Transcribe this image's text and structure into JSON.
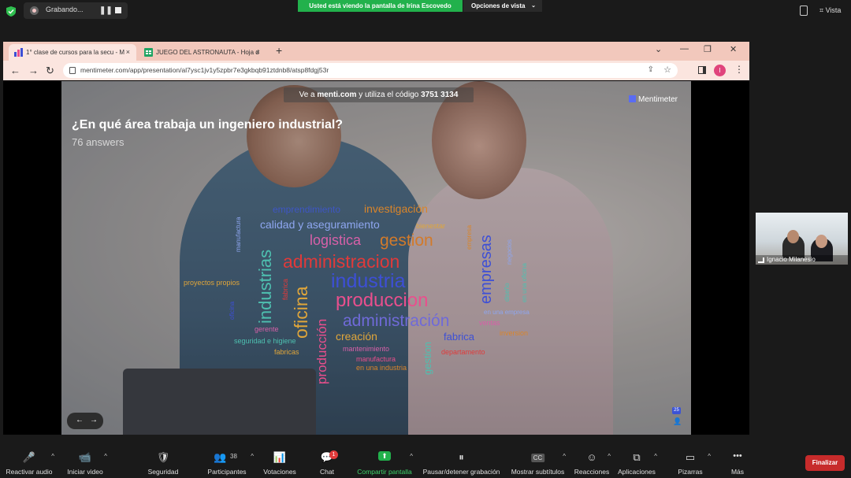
{
  "zoom_top": {
    "recording_label": "Grabando...",
    "pause_symbol": "❚❚",
    "share_banner": "Usted está viendo la pantalla de Irina Escovedo",
    "view_options": "Opciones de vista",
    "view_options_chevron": "⌄",
    "view_button": "Vista",
    "view_button_icon": "⌗"
  },
  "browser": {
    "tabs": [
      {
        "label": "1° clase de cursos para la secu - M"
      },
      {
        "label": "JUEGO DEL ASTRONAUTA - Hoja d"
      }
    ],
    "tab_close": "×",
    "new_tab": "+",
    "window_controls": [
      "⌄",
      "—",
      "❐",
      "✕"
    ],
    "nav": [
      "←",
      "→",
      "↻"
    ],
    "url": "mentimeter.com/app/presentation/al7ysc1jv1y5zpbr7e3gkbqb91ztdnb8/atsp8fdgj53r",
    "share_icon": "⇪",
    "star_icon": "☆",
    "profile_initial": "I",
    "menu_icon": "⋮"
  },
  "slide": {
    "banner_prefix": "Ve a",
    "banner_site": "menti.com",
    "banner_middle": "y utiliza el código",
    "banner_code": "3751 3134",
    "logo": "Mentimeter",
    "question": "¿En qué área trabaja un ingeniero industrial?",
    "answers": "76 answers",
    "reaction_count": "25",
    "person_icon": "👤",
    "nav_prev": "←",
    "nav_next": "→"
  },
  "word_cloud": [
    {
      "text": "emprendimiento",
      "color": "#3e56c4"
    },
    {
      "text": "investigación",
      "color": "#d9852a"
    },
    {
      "text": "calidad y aseguramiento",
      "color": "#8ea6f0"
    },
    {
      "text": "bienestar",
      "color": "#e0a63a"
    },
    {
      "text": "logistica",
      "color": "#d760a8"
    },
    {
      "text": "gestion",
      "color": "#d27a2a"
    },
    {
      "text": "administracion",
      "color": "#e03a3a"
    },
    {
      "text": "industria",
      "color": "#3d4fd6"
    },
    {
      "text": "produccion",
      "color": "#e94f8d"
    },
    {
      "text": "administración",
      "color": "#6f6ad8"
    },
    {
      "text": "proyectos propios",
      "color": "#e0a63a"
    },
    {
      "text": "en una empresa",
      "color": "#8ea6f0"
    },
    {
      "text": "ventas",
      "color": "#d760a8"
    },
    {
      "text": "gerente",
      "color": "#d760a8"
    },
    {
      "text": "creación",
      "color": "#e0a63a"
    },
    {
      "text": "fabrica",
      "color": "#3d4fd6"
    },
    {
      "text": "seguridad e higiene",
      "color": "#4ec0b0"
    },
    {
      "text": "inversion",
      "color": "#d9852a"
    },
    {
      "text": "fabricas",
      "color": "#e0a63a"
    },
    {
      "text": "mantenimiento",
      "color": "#d760a8"
    },
    {
      "text": "departamento",
      "color": "#e03a3a"
    },
    {
      "text": "manufactura",
      "color": "#e94f8d"
    },
    {
      "text": "en una industria",
      "color": "#d9852a"
    },
    {
      "text": "manufactura",
      "color": "#8ea6f0"
    },
    {
      "text": "industrias",
      "color": "#4ec0b0"
    },
    {
      "text": "fabrica",
      "color": "#e03a3a"
    },
    {
      "text": "oficina",
      "color": "#e0a63a"
    },
    {
      "text": "producción",
      "color": "#e94f8d"
    },
    {
      "text": "gestion",
      "color": "#4ec0b0"
    },
    {
      "text": "empresas",
      "color": "#3d4fd6"
    },
    {
      "text": "empresa",
      "color": "#d9852a"
    },
    {
      "text": "negocios",
      "color": "#8ea6f0"
    },
    {
      "text": "diseño",
      "color": "#4ec0b0"
    },
    {
      "text": "en una oficina",
      "color": "#4ec0b0"
    },
    {
      "text": "oficina",
      "color": "#3d4fd6"
    }
  ],
  "participant": {
    "name": "Ignacio Milanesio"
  },
  "toolbar": {
    "items": [
      {
        "label": "Reactivar audio",
        "icon": "🎤"
      },
      {
        "label": "Iniciar video",
        "icon": "📹"
      },
      {
        "label": "Seguridad",
        "icon": "🛡"
      },
      {
        "label": "Participantes",
        "icon": "👥",
        "count": "38"
      },
      {
        "label": "Votaciones",
        "icon": "📊"
      },
      {
        "label": "Chat",
        "icon": "💬"
      },
      {
        "label": "Compartir pantalla",
        "icon": "⬆"
      },
      {
        "label": "Pausar/detener grabación",
        "icon": "⏸"
      },
      {
        "label": "Mostrar subtítulos",
        "icon": "CC"
      },
      {
        "label": "Reacciones",
        "icon": "☺"
      },
      {
        "label": "Aplicaciones",
        "icon": "⧉"
      },
      {
        "label": "Pizarras",
        "icon": "▭"
      },
      {
        "label": "Más",
        "icon": "•••"
      }
    ],
    "caret": "^",
    "chat_badge": "1",
    "end_button": "Finalizar"
  },
  "colors": {
    "share_green": "#22b14c",
    "end_red": "#c72b2b",
    "tabstrip": "#f2c8bc"
  }
}
